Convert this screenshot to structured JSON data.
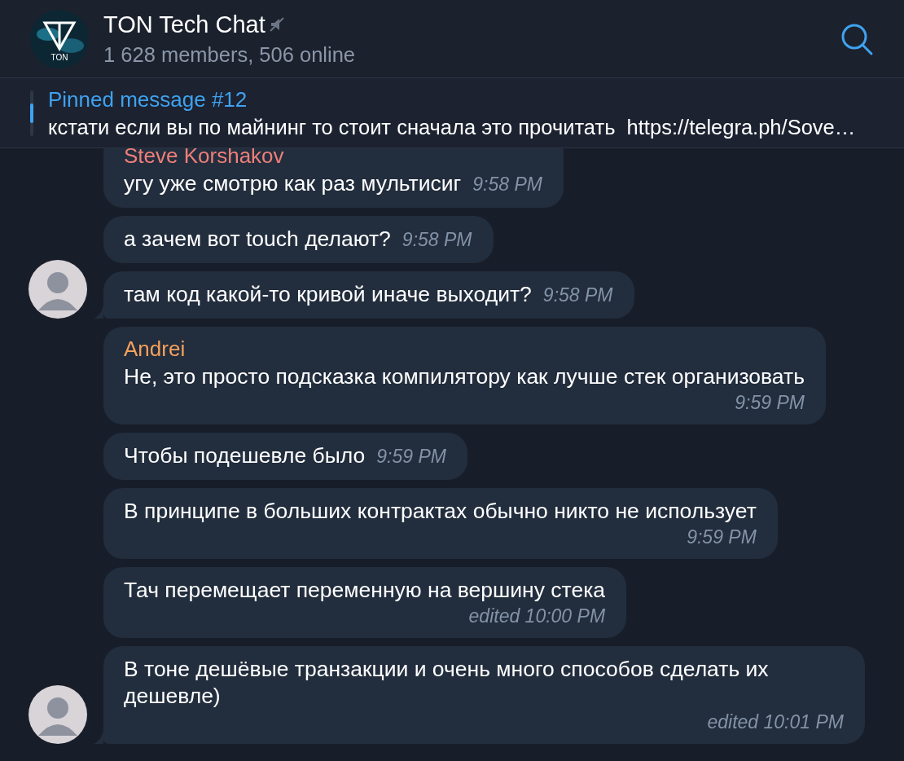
{
  "header": {
    "title": "TON Tech Chat",
    "muted": true,
    "subtitle": "1 628 members, 506 online",
    "avatar_label": "TON"
  },
  "pinned": {
    "title": "Pinned message #12",
    "text": "кстати если вы по майнинг то стоит сначала это прочитать  https://telegra.ph/Sove…"
  },
  "groups": [
    {
      "messages": [
        {
          "kind": "inline",
          "name": "Steve Korshakov",
          "color": "#ee7f78",
          "text": "угу уже смотрю как раз мультисиг",
          "time": "9:58 PM"
        },
        {
          "kind": "inline",
          "text": "а зачем вот touch делают?",
          "time": "9:58 PM"
        },
        {
          "kind": "inline",
          "text": "там код какой-то кривой иначе выходит?",
          "time": "9:58 PM"
        }
      ]
    },
    {
      "messages": [
        {
          "kind": "stacked",
          "name": "Andrei",
          "color": "#f5a15d",
          "text": "Не, это просто подсказка компилятору как лучше стек организовать",
          "time": "9:59 PM"
        },
        {
          "kind": "inline",
          "text": "Чтобы подешевле было",
          "time": "9:59 PM"
        },
        {
          "kind": "stacked",
          "text": "В принципе в больших контрактах обычно никто не использует",
          "time": "9:59 PM"
        },
        {
          "kind": "stacked",
          "text": "Тач перемещает переменную на вершину стека",
          "time": "edited 10:00 PM"
        },
        {
          "kind": "stacked",
          "text": "В тоне дешёвые транзакции и очень много способов сделать их дешевле)",
          "time": "edited 10:01 PM"
        }
      ]
    }
  ]
}
